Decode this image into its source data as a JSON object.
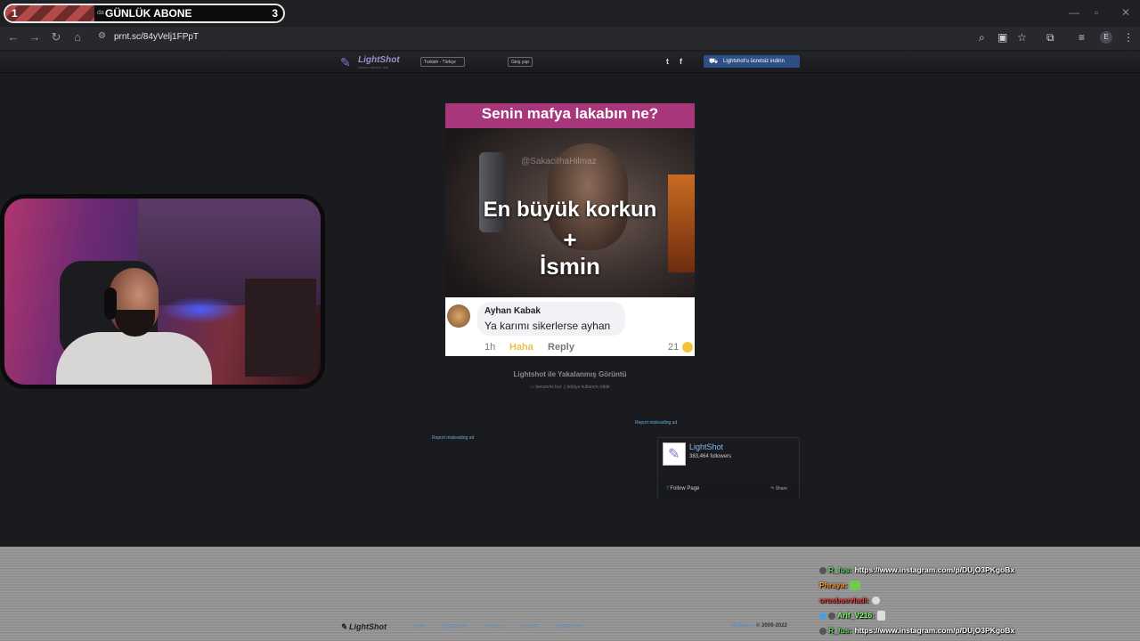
{
  "browser": {
    "tab": {
      "num_left": "1",
      "tiny_text": "da",
      "title": "GÜNLÜK ABONE",
      "num_right": "3"
    },
    "url": "prnt.sc/84yVelj1FPpT",
    "avatar_letter": "E",
    "icons": [
      "back-icon",
      "forward-icon",
      "reload-icon",
      "home-icon",
      "site-info-icon",
      "zoom-icon",
      "install-icon",
      "bookmark-star-icon",
      "extensions-icon",
      "tab-list-icon",
      "menu-dots-icon"
    ]
  },
  "header": {
    "logo_name": "LightShot",
    "logo_sub": "screen capture tool",
    "language": "Turkish - Türkçe",
    "login": "Giriş yap",
    "twitter": "t",
    "facebook": "f",
    "download": "Lightshot'u ücretsiz indirin"
  },
  "screenshot": {
    "question": "Senin mafya lakabın ne?",
    "watermark": "@SakaciIhaHilmaz",
    "line1": "En büyük korkun",
    "plus": "+",
    "line2": "İsmin",
    "comment_name": "Ayhan Kabak",
    "comment_text": "Ya karımı sikerlerse ayhan",
    "meta_time": "1h",
    "meta_haha": "Haha",
    "meta_reply": "Reply",
    "meta_count": "21"
  },
  "caption": "Lightshot ile Yakalanmış Görüntü",
  "actions": {
    "similar": "benzerini bul",
    "report": "kötüye kullanımı bildir"
  },
  "report_ad_1": "Report misleading ad",
  "report_ad_2": "Report misleading ad",
  "fb_widget": {
    "name": "LightShot",
    "followers": "383,464 followers",
    "follow": "Follow Page",
    "share": "Share"
  },
  "footer": {
    "logo": "LightShot",
    "links": [
      "İndir",
      "Öğreticiler",
      "Privacy",
      "Yardım",
      "Reklam Ver"
    ],
    "copyright_brand": "Skillbrains",
    "copyright": "© 2009-2022"
  },
  "chat": [
    {
      "user": "R_fus:",
      "user_color": "#5fd85f",
      "text": "https://www.instagram.com/p/DUjO3PKgoBx"
    },
    {
      "user": "Phraya:",
      "user_color": "#ff9a2e",
      "text": ""
    },
    {
      "user": "orosbuevladi:",
      "user_color": "#e83a3a",
      "text": ""
    },
    {
      "user": "Arif_V216:",
      "user_color": "#7dff6a",
      "text": ""
    },
    {
      "user": "R_fus:",
      "user_color": "#5fd85f",
      "text": "https://www.instagram.com/p/DUjO3PKgoBx"
    }
  ],
  "colors": {
    "page_bg": "#1a1b1e",
    "download_btn": "#2d4f85",
    "link": "#6ea9d9"
  }
}
